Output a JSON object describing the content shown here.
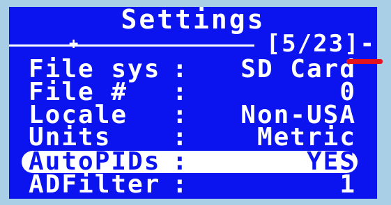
{
  "screen": {
    "title": "Settings",
    "page_indicator": "[5/23]-",
    "marker": "+"
  },
  "settings_rows": [
    {
      "label": "File sys",
      "colon": ":",
      "value": "SD Card"
    },
    {
      "label": "File #",
      "colon": ":",
      "value": "0"
    },
    {
      "label": "Locale",
      "colon": ":",
      "value": "Non-USA"
    },
    {
      "label": "Units",
      "colon": ":",
      "value": "Metric"
    },
    {
      "label": "AutoPIDs",
      "colon": ":",
      "value": "YES"
    },
    {
      "label": "ADFilter",
      "colon": ":",
      "value": "1"
    }
  ],
  "colors": {
    "screen_bg": "#0b14ee",
    "frame_bg": "#a9cfe6",
    "text": "#ffffff",
    "pointer": "#e3141e"
  }
}
